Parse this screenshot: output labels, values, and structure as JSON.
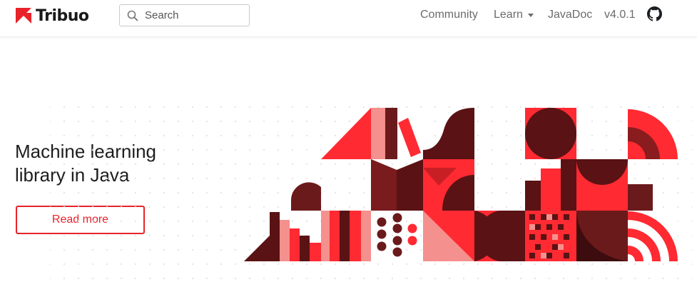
{
  "brand": {
    "name": "Tribuo",
    "logo_icon": "tribuo-logo-icon"
  },
  "search": {
    "placeholder": "Search",
    "value": "",
    "icon": "search-icon"
  },
  "nav": {
    "community": "Community",
    "learn": "Learn",
    "javadoc": "JavaDoc",
    "version": "v4.0.1",
    "github_icon": "github-icon"
  },
  "hero": {
    "title_line1": "Machine learning",
    "title_line2": "library in Java",
    "cta": "Read more"
  },
  "colors": {
    "red": "#ff2a32",
    "dark": "#5a1214",
    "pink": "#f4908d",
    "dots": "#e6e6e6"
  }
}
